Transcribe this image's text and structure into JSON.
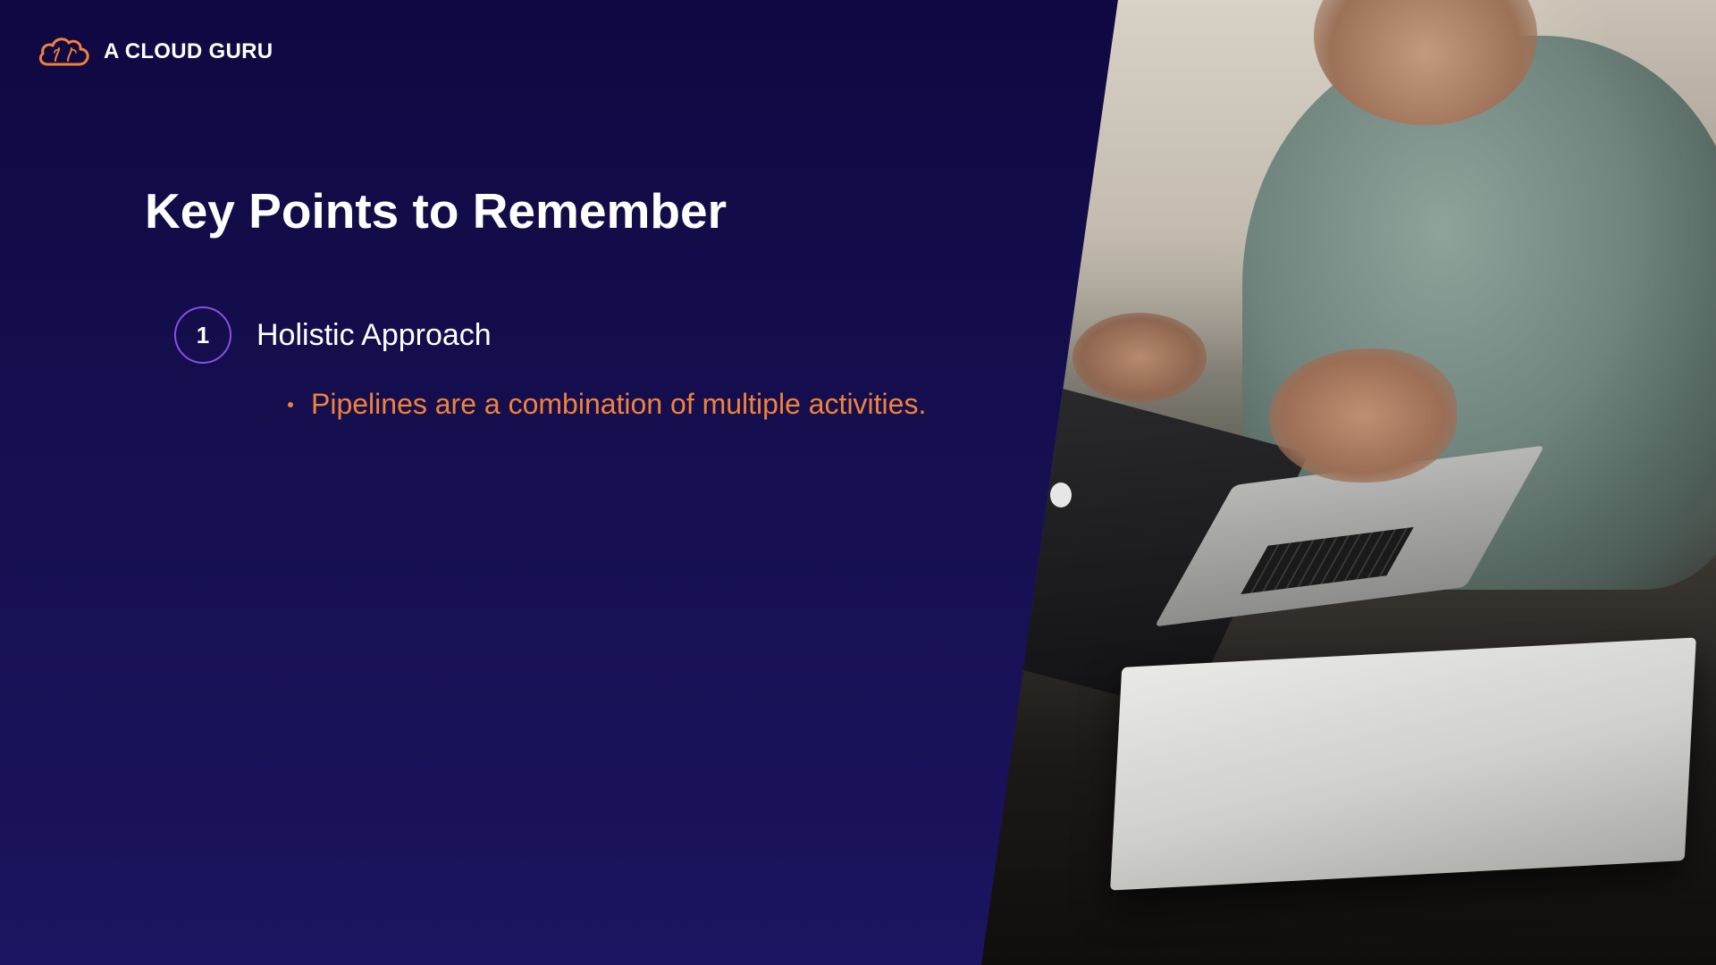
{
  "brand": {
    "name": "A CLOUD GURU",
    "icon": "cloud-logo-icon",
    "accent": "#f0823a"
  },
  "slide": {
    "title": "Key Points to Remember",
    "points": [
      {
        "number": "1",
        "label": "Holistic Approach",
        "bullets": [
          "Pipelines are a combination of multiple activities."
        ]
      }
    ]
  },
  "colors": {
    "background": "#150f4f",
    "number_ring": "#8a4fe6",
    "bullet_text": "#f0823a",
    "heading_text": "#ffffff"
  },
  "photo": {
    "icon": "person-with-laptop-photo"
  }
}
